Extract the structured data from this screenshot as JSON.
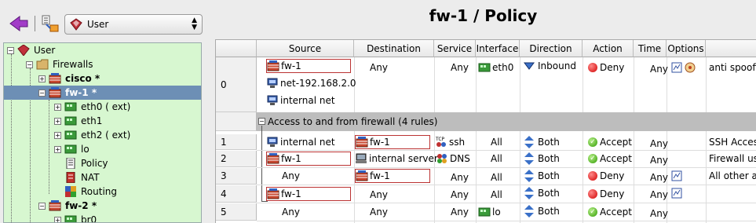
{
  "library_select": {
    "value": "User"
  },
  "tree": {
    "items": [
      {
        "label": "User",
        "bold": false
      },
      {
        "label": "Firewalls",
        "bold": false
      },
      {
        "label": "cisco *",
        "bold": true
      },
      {
        "label": "fw-1 *",
        "bold": true
      },
      {
        "label": "eth0 ( ext)",
        "bold": false
      },
      {
        "label": "eth1",
        "bold": false
      },
      {
        "label": "eth2 ( ext)",
        "bold": false
      },
      {
        "label": "lo",
        "bold": false
      },
      {
        "label": "Policy",
        "bold": false
      },
      {
        "label": "NAT",
        "bold": false
      },
      {
        "label": "Routing",
        "bold": false
      },
      {
        "label": "fw-2 *",
        "bold": true
      },
      {
        "label": "br0",
        "bold": false
      }
    ]
  },
  "policy": {
    "title": "fw-1 / Policy",
    "columns": [
      "Source",
      "Destination",
      "Service",
      "Interface",
      "Direction",
      "Action",
      "Time",
      "Options"
    ],
    "group_label": "Access to and from firewall (4 rules)",
    "rows": [
      {
        "num": "0",
        "source": [
          "fw-1",
          "net-192.168.2.0",
          "internal net"
        ],
        "destination": "Any",
        "service": "Any",
        "interface": "eth0",
        "direction": "Inbound",
        "action": "Deny",
        "time": "Any",
        "comment": "anti spoofin"
      },
      {
        "num": "1",
        "source": "internal net",
        "destination": "fw-1",
        "service": "ssh",
        "interface": "All",
        "direction": "Both",
        "action": "Accept",
        "time": "Any",
        "comment": "SSH Acces"
      },
      {
        "num": "2",
        "source": "fw-1",
        "destination": "internal server",
        "service": "DNS",
        "interface": "All",
        "direction": "Both",
        "action": "Accept",
        "time": "Any",
        "comment": "Firewall use"
      },
      {
        "num": "3",
        "source": "Any",
        "destination": "fw-1",
        "service": "Any",
        "interface": "All",
        "direction": "Both",
        "action": "Deny",
        "time": "Any",
        "comment": "All other att"
      },
      {
        "num": "4",
        "source": "fw-1",
        "destination": "Any",
        "service": "Any",
        "interface": "All",
        "direction": "Both",
        "action": "Deny",
        "time": "Any",
        "comment": ""
      },
      {
        "num": "5",
        "source": "Any",
        "destination": "Any",
        "service": "Any",
        "interface": "lo",
        "direction": "Both",
        "action": "Accept",
        "time": "Any",
        "comment": ""
      }
    ]
  },
  "colors": {
    "tree_bg": "#d7f7d0",
    "selected_bg": "#6d8fb5",
    "group_bg": "#bdbdbd",
    "deny": "#d10000",
    "accept": "#2e9a00"
  }
}
